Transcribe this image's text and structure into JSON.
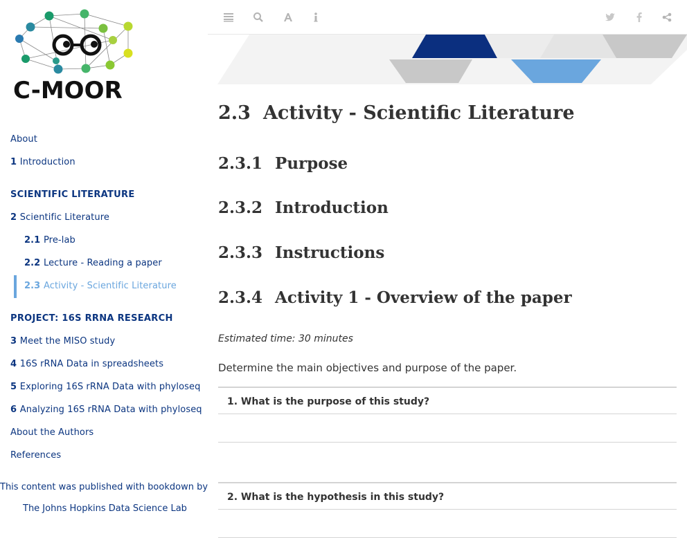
{
  "sidebar": {
    "logo_text": "C-MOOR",
    "items": [
      {
        "num": "",
        "label": "About"
      },
      {
        "num": "1",
        "label": "Introduction"
      },
      {
        "section": "SCIENTIFIC LITERATURE"
      },
      {
        "num": "2",
        "label": "Scientific Literature"
      },
      {
        "num": "2.1",
        "label": "Pre-lab"
      },
      {
        "num": "2.2",
        "label": "Lecture - Reading a paper"
      },
      {
        "num": "2.3",
        "label": "Activity - Scientific Literature"
      },
      {
        "section": "PROJECT: 16S RRNA RESEARCH"
      },
      {
        "num": "3",
        "label": "Meet the MISO study"
      },
      {
        "num": "4",
        "label": "16S rRNA Data in spreadsheets"
      },
      {
        "num": "5",
        "label": "Exploring 16S rRNA Data with phyloseq"
      },
      {
        "num": "6",
        "label": "Analyzing 16S rRNA Data with phyloseq"
      },
      {
        "num": "",
        "label": "About the Authors"
      },
      {
        "num": "",
        "label": "References"
      }
    ],
    "published_label": "This content was published with bookdown by:",
    "publisher": "The Johns Hopkins Data Science Lab"
  },
  "toolbar": {
    "left_icons": [
      "menu-icon",
      "search-icon",
      "font-icon",
      "info-icon"
    ],
    "right_icons": [
      "twitter-icon",
      "facebook-icon",
      "share-icon"
    ]
  },
  "main": {
    "title_num": "2.3",
    "title": "Activity - Scientific Literature",
    "sections": [
      {
        "num": "2.3.1",
        "title": "Purpose"
      },
      {
        "num": "2.3.2",
        "title": "Introduction"
      },
      {
        "num": "2.3.3",
        "title": "Instructions"
      },
      {
        "num": "2.3.4",
        "title": "Activity 1 - Overview of the paper"
      }
    ],
    "estimated_time": "Estimated time: 30 minutes",
    "paragraph": "Determine the main objectives and purpose of the paper.",
    "questions": [
      "1. What is the purpose of this study?",
      "2. What is the hypothesis in this study?"
    ]
  },
  "colors": {
    "nav_link": "#0b3580",
    "nav_active": "#6aa6de",
    "heading": "#333333",
    "banner_dark": "#0b2f7f",
    "banner_light": "#6aa6de",
    "banner_gray": "#c8c8c8"
  }
}
